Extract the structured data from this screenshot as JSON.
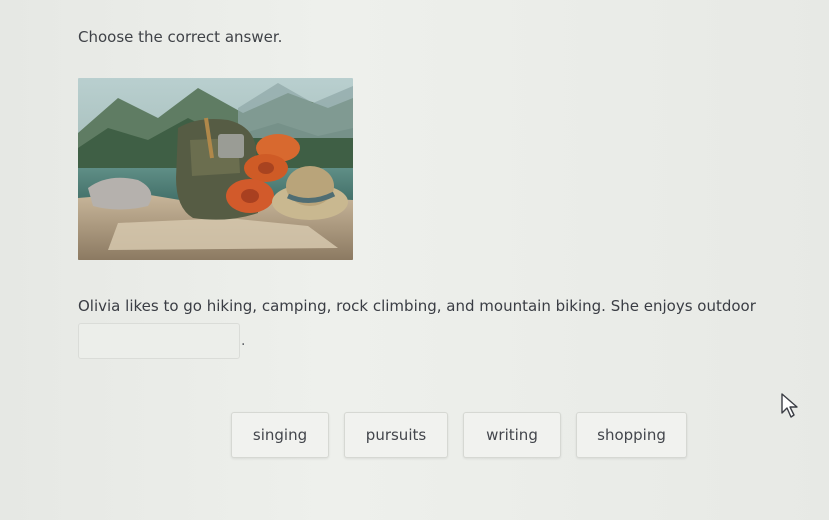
{
  "question": {
    "instruction": "Choose the correct answer.",
    "sentence": "Olivia likes to go hiking, camping, rock climbing, and mountain biking. She enjoys outdoor",
    "blank_trailing": "."
  },
  "choices": [
    "singing",
    "pursuits",
    "writing",
    "shopping"
  ],
  "image": {
    "content": "camping backpack, rolled sleeping mats, straw hat on rocks by a mountain lake"
  }
}
